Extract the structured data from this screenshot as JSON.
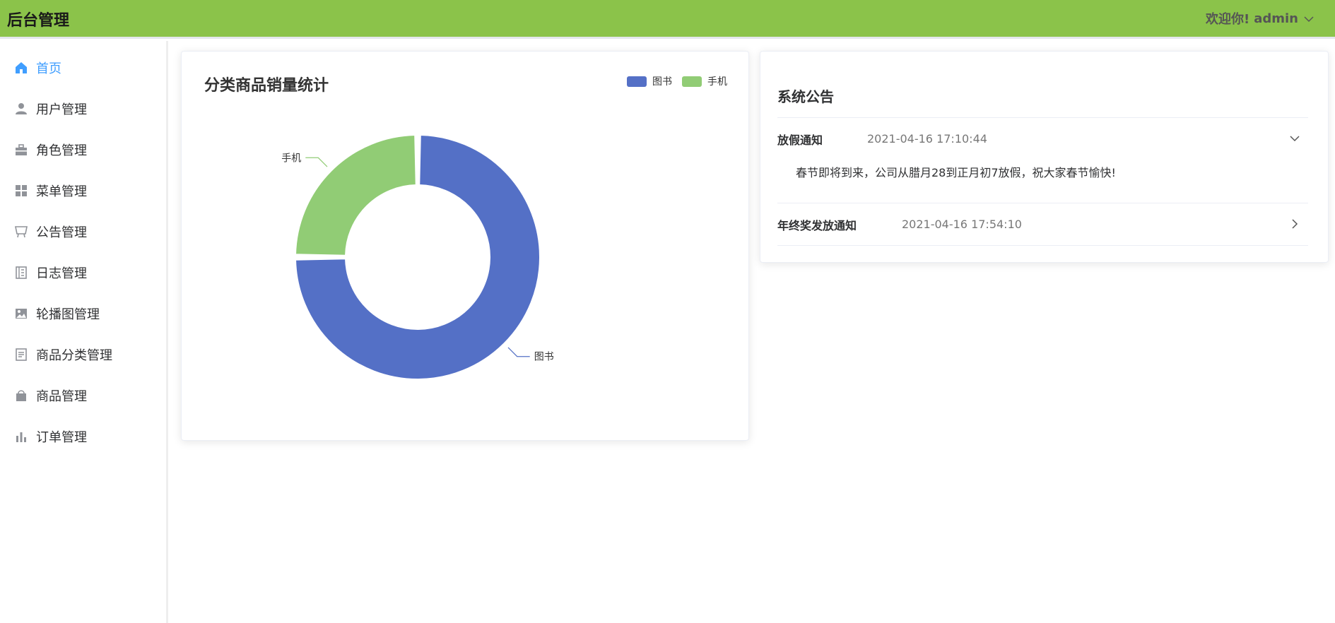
{
  "header": {
    "title": "后台管理",
    "welcome": "欢迎你!",
    "username": "admin"
  },
  "sidebar": {
    "active_color": "#409eff",
    "items": [
      {
        "label": "首页",
        "icon": "home-icon",
        "active": true
      },
      {
        "label": "用户管理",
        "icon": "user-icon"
      },
      {
        "label": "角色管理",
        "icon": "briefcase-icon"
      },
      {
        "label": "菜单管理",
        "icon": "grid-icon"
      },
      {
        "label": "公告管理",
        "icon": "easel-icon"
      },
      {
        "label": "日志管理",
        "icon": "notebook-icon"
      },
      {
        "label": "轮播图管理",
        "icon": "picture-icon"
      },
      {
        "label": "商品分类管理",
        "icon": "document-icon"
      },
      {
        "label": "商品管理",
        "icon": "shopping-bag-icon"
      },
      {
        "label": "订单管理",
        "icon": "bar-chart-icon"
      }
    ]
  },
  "chart_data": {
    "type": "pie",
    "title": "分类商品销量统计",
    "donut": true,
    "legend": "top-right",
    "slices": [
      {
        "name": "图书",
        "value": 75,
        "color": "#5470c6"
      },
      {
        "name": "手机",
        "value": 25,
        "color": "#91cc75"
      }
    ]
  },
  "notices": {
    "title": "系统公告",
    "items": [
      {
        "title": "放假通知",
        "time": "2021-04-16 17:10:44",
        "expanded": true,
        "content": "春节即将到来，公司从腊月28到正月初7放假，祝大家春节愉快!"
      },
      {
        "title": "年终奖发放通知",
        "time": "2021-04-16 17:54:10",
        "expanded": false
      }
    ]
  }
}
